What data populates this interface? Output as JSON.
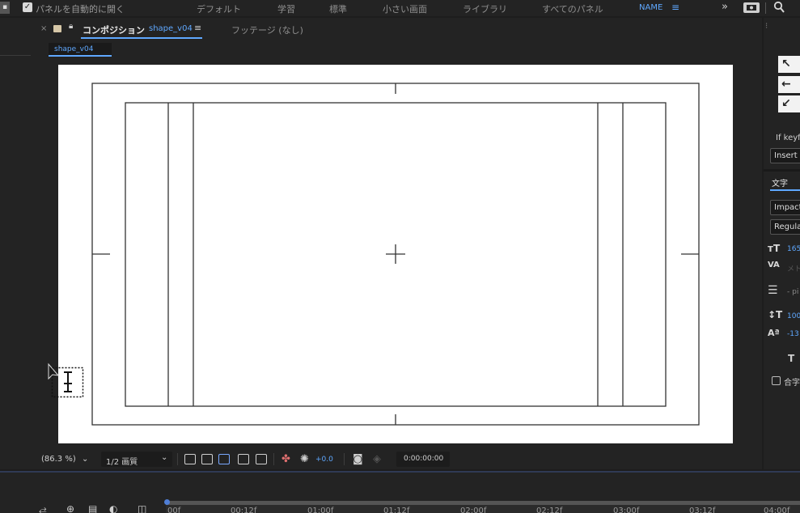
{
  "topbar": {
    "auto_open_label": "パネルを自動的に開く",
    "workspaces": [
      "デフォルト",
      "学習",
      "標準",
      "小さい画面",
      "ライブラリ",
      "すべてのパネル",
      "NAME"
    ],
    "active_workspace": "NAME",
    "more_glyph": "»"
  },
  "comp_panel": {
    "close_glyph": "×",
    "tab_label": "コンポジション",
    "comp_name": "shape_v04",
    "menu_glyph": "≡",
    "footage_tab": "フッテージ (なし)",
    "breadcrumb": "shape_v04"
  },
  "footer": {
    "zoom": "(86.3 %)",
    "resolution": "1/2 画質",
    "exposure": "+0.0",
    "timecode": "0:00:00:00"
  },
  "right_panel": {
    "keyframe_label": "If keyf",
    "insert_label": "Insert",
    "char_tab": "文字",
    "font_family": "Impact",
    "font_style": "Regular",
    "font_size": "165",
    "kerning": "メト",
    "leading": "- pi",
    "vertical_scale": "100",
    "baseline": "-13",
    "faux_label": "T",
    "ligature_label": "合字"
  },
  "timeline": {
    "ticks": [
      "00f",
      "00:12f",
      "01:00f",
      "01:12f",
      "02:00f",
      "02:12f",
      "03:00f",
      "03:12f",
      "04:00f"
    ]
  },
  "colors": {
    "accent": "#5fa8ff",
    "panel_bg": "#232323",
    "canvas": "#ffffff"
  }
}
